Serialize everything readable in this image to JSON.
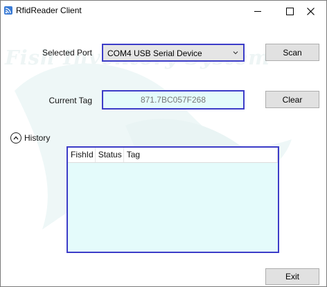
{
  "window": {
    "title": "RfidReader Client",
    "app_icon": "rss-feed-icon"
  },
  "watermark": {
    "text": "Fish Inventory System"
  },
  "port": {
    "label": "Selected Port",
    "selected": "COM4 USB Serial Device",
    "scan_button": "Scan"
  },
  "tag": {
    "label": "Current Tag",
    "value": "871.7BC057F268",
    "clear_button": "Clear"
  },
  "history": {
    "label": "History",
    "columns": [
      "FishId",
      "Status",
      "Tag"
    ],
    "rows": []
  },
  "footer": {
    "exit_button": "Exit"
  },
  "colors": {
    "focus_border": "#3c3cc8",
    "field_background": "#e4fbfb",
    "button_background": "#e1e1e1"
  }
}
